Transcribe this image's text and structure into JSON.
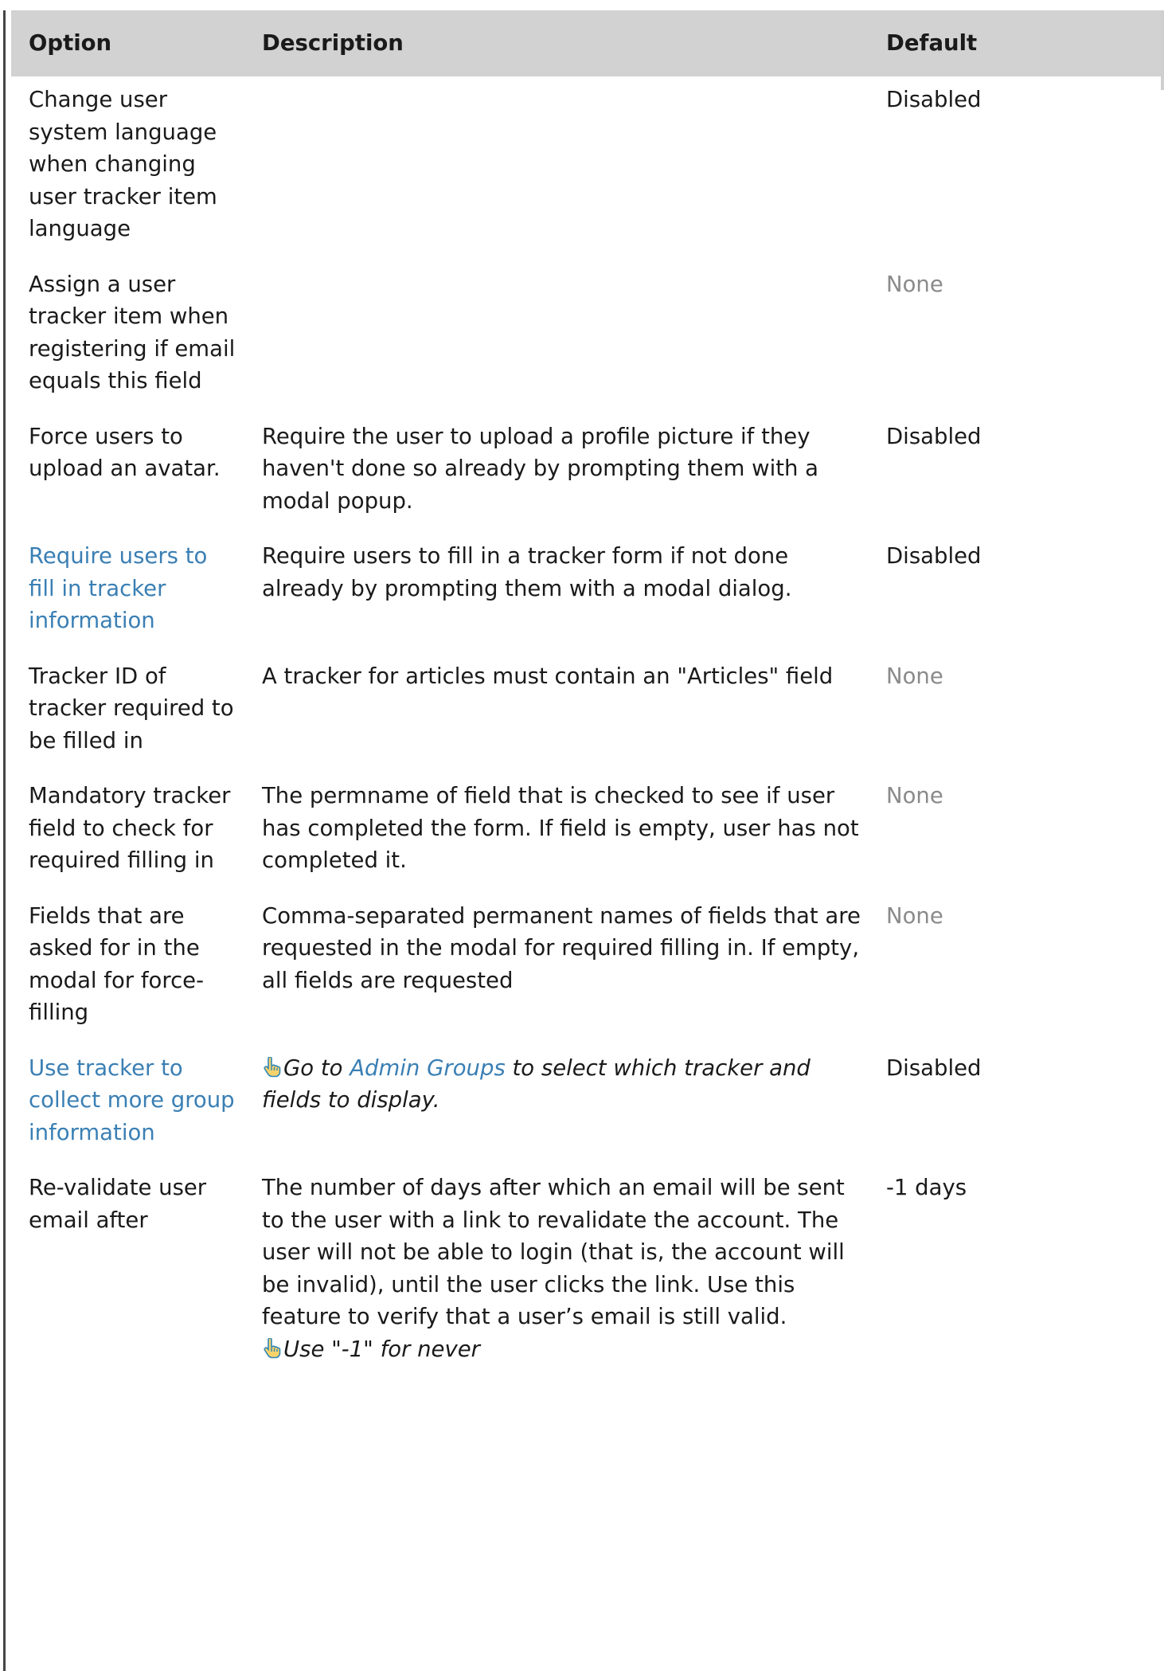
{
  "columns": {
    "option": "Option",
    "description": "Description",
    "default": "Default"
  },
  "rows": [
    {
      "option": "Change user system language when changing user tracker item language",
      "description": "",
      "default": "Disabled"
    },
    {
      "option": "Assign a user tracker item when registering if email equals this field",
      "description": "",
      "default": "None"
    },
    {
      "option": "Force users to upload an avatar.",
      "description": "Require the user to upload a profile picture if they haven't done so already by prompting them with a modal popup.",
      "default": "Disabled"
    },
    {
      "option": "Require users to fill in tracker information",
      "description": "Require users to fill in a tracker form if not done already by prompting them with a modal dialog.",
      "default": "Disabled"
    },
    {
      "option": "Tracker ID of tracker required to be filled in",
      "description": "A tracker for articles must contain an \"Articles\" field",
      "default": "None"
    },
    {
      "option": "Mandatory tracker field to check for required filling in",
      "description": "The permname of field that is checked to see if user has completed the form. If field is empty, user has not completed it.",
      "default": "None"
    },
    {
      "option": "Fields that are asked for in the modal for force-filling",
      "description": "Comma-separated permanent names of fields that are requested in the modal for required filling in. If empty, all fields are requested",
      "default": "None"
    },
    {
      "option": "Use tracker to collect more group information",
      "note_before": "Go to",
      "note_link": "Admin Groups",
      "note_after": "to select which tracker and fields to display.",
      "default": "Disabled"
    },
    {
      "option": "Re-validate user email after",
      "description": "The number of days after which an email will be sent to the user with a link to revalidate the account. The user will not be able to login (that is, the account will be invalid), until the user clicks the link. Use this feature to verify that a user’s email is still valid.",
      "note": "Use \"-1\" for never",
      "default": "-1 days"
    }
  ],
  "icons": {
    "hint": "pointing-hand-icon"
  },
  "colors": {
    "header_bg": "#d2d2d2",
    "link": "#3a7fb4",
    "muted": "#8a8a8a"
  }
}
